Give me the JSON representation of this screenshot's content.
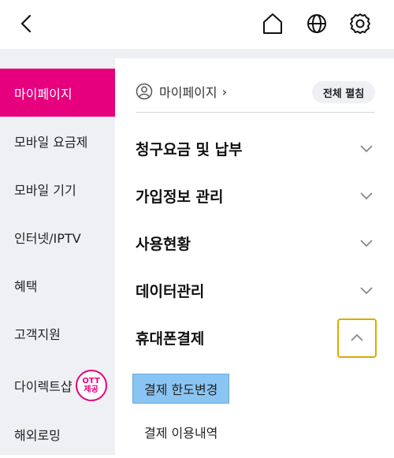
{
  "topbar": {
    "back_icon": "chevron-left-icon",
    "home_icon": "home-icon",
    "globe_icon": "globe-icon",
    "settings_icon": "gear-icon"
  },
  "sidebar": {
    "items": [
      {
        "label": "마이페이지",
        "active": true
      },
      {
        "label": "모바일 요금제"
      },
      {
        "label": "모바일 기기"
      },
      {
        "label": "인터넷/IPTV"
      },
      {
        "label": "혜택"
      },
      {
        "label": "고객지원"
      },
      {
        "label": "다이렉트샵",
        "badge_line1": "OTT",
        "badge_line2": "제공"
      },
      {
        "label": "해외로밍"
      }
    ]
  },
  "main": {
    "breadcrumb": "마이페이지",
    "expand_all": "전체 펼침",
    "sections": [
      {
        "label": "청구요금 및 납부",
        "expanded": false
      },
      {
        "label": "가입정보 관리",
        "expanded": false
      },
      {
        "label": "사용현황",
        "expanded": false
      },
      {
        "label": "데이터관리",
        "expanded": false
      },
      {
        "label": "휴대폰결제",
        "expanded": true
      }
    ],
    "sub_items": [
      {
        "label": "결제 한도변경",
        "highlighted": true
      },
      {
        "label": "결제 이용내역"
      }
    ]
  },
  "colors": {
    "accent": "#e6007e",
    "sidebar_bg": "#eef0f4",
    "focus": "#e0a800",
    "highlight": "#8ac4f2"
  }
}
